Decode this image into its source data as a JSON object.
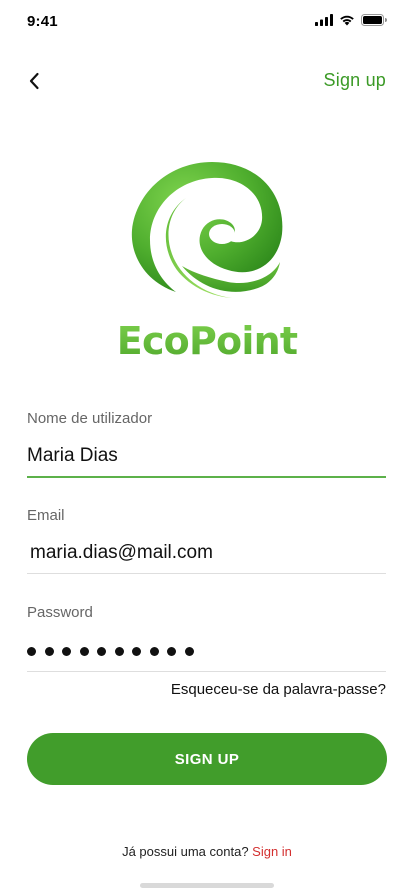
{
  "status_bar": {
    "time": "9:41"
  },
  "nav": {
    "signup_link": "Sign up"
  },
  "logo": {
    "text": "EcoPoint"
  },
  "form": {
    "username": {
      "label": "Nome de utilizador",
      "value": "Maria Dias"
    },
    "email": {
      "label": "Email",
      "value": "maria.dias@mail.com"
    },
    "password": {
      "label": "Password",
      "masked_length": 10
    }
  },
  "forgot_password": "Esqueceu-se da palavra-passe?",
  "submit_button": "SIGN UP",
  "footer": {
    "prompt": "Já possui uma conta?",
    "signin_link": "Sign in"
  },
  "colors": {
    "brand_green": "#419d2b",
    "link_green": "#3b9a26",
    "signin_red": "#d32f2f"
  },
  "icons": {
    "back": "chevron-left-icon",
    "signal": "signal-icon",
    "wifi": "wifi-icon",
    "battery": "battery-icon"
  }
}
